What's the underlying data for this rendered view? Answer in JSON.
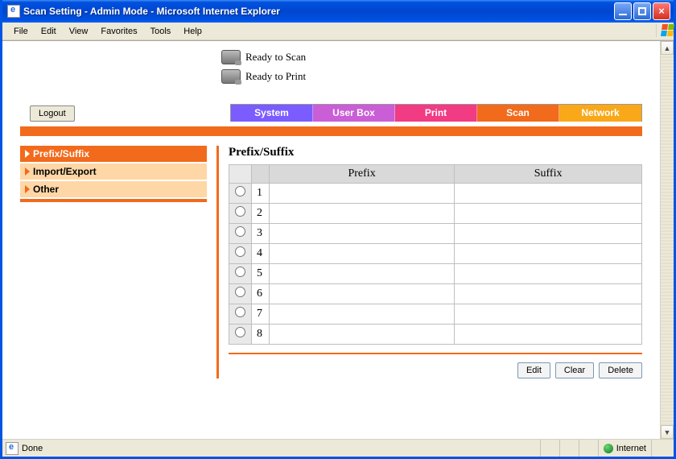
{
  "window": {
    "title": "Scan Setting - Admin Mode - Microsoft Internet Explorer"
  },
  "menubar": {
    "items": [
      "File",
      "Edit",
      "View",
      "Favorites",
      "Tools",
      "Help"
    ]
  },
  "status": {
    "scan": "Ready to Scan",
    "print": "Ready to Print"
  },
  "logout_label": "Logout",
  "tabs": {
    "system": "System",
    "userbox": "User Box",
    "print": "Print",
    "scan": "Scan",
    "network": "Network"
  },
  "sidebar": {
    "items": [
      {
        "label": "Prefix/Suffix"
      },
      {
        "label": "Import/Export"
      },
      {
        "label": "Other"
      }
    ]
  },
  "section_title": "Prefix/Suffix",
  "table": {
    "headers": {
      "col_prefix": "Prefix",
      "col_suffix": "Suffix"
    },
    "rows": [
      {
        "n": "1",
        "prefix": "",
        "suffix": ""
      },
      {
        "n": "2",
        "prefix": "",
        "suffix": ""
      },
      {
        "n": "3",
        "prefix": "",
        "suffix": ""
      },
      {
        "n": "4",
        "prefix": "",
        "suffix": ""
      },
      {
        "n": "5",
        "prefix": "",
        "suffix": ""
      },
      {
        "n": "6",
        "prefix": "",
        "suffix": ""
      },
      {
        "n": "7",
        "prefix": "",
        "suffix": ""
      },
      {
        "n": "8",
        "prefix": "",
        "suffix": ""
      }
    ]
  },
  "actions": {
    "edit": "Edit",
    "clear": "Clear",
    "delete": "Delete"
  },
  "statusbar": {
    "done": "Done",
    "zone": "Internet"
  }
}
